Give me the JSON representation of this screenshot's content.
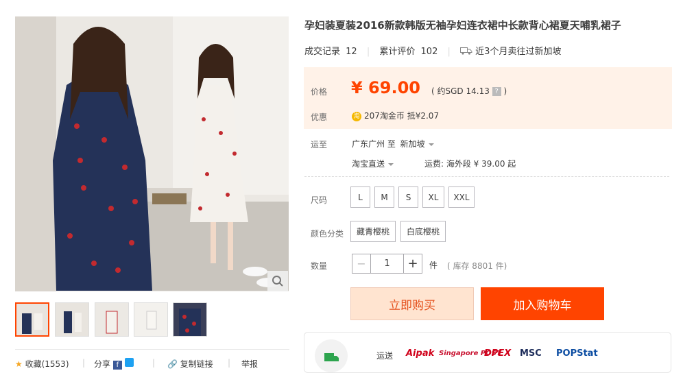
{
  "product": {
    "title": "孕妇装夏装2016新款韩版无袖孕妇连衣裙中长款背心裙夏天哺乳裙子"
  },
  "stats": {
    "sales_label": "成交记录",
    "sales_count": "12",
    "reviews_label": "累计评价",
    "reviews_count": "102",
    "shipping_note": "近3个月卖往过新加坡"
  },
  "price": {
    "label": "价格",
    "value": "¥ 69.00",
    "sgd_prefix": "( 约SGD",
    "sgd_value": "14.13",
    "sgd_suffix": ")",
    "help": "?"
  },
  "promo": {
    "label": "优惠",
    "coin_icon_text": "淘",
    "text": "207淘金币 抵¥2.07"
  },
  "delivery": {
    "label": "运至",
    "from": "广东广州 至",
    "to": "新加坡",
    "method": "淘宝直送",
    "fee": "运费: 海外段 ¥ 39.00 起"
  },
  "size": {
    "label": "尺码",
    "options": [
      "L",
      "M",
      "S",
      "XL",
      "XXL"
    ]
  },
  "color": {
    "label": "颜色分类",
    "options": [
      "藏青樱桃",
      "白底樱桃"
    ]
  },
  "quantity": {
    "label": "数量",
    "value": "1",
    "unit": "件",
    "stock": "( 库存 8801 件)",
    "minus": "−",
    "plus": "+"
  },
  "buttons": {
    "buy_now": "立即购买",
    "add_to_cart": "加入购物车"
  },
  "shipping_partners": {
    "label": "运送",
    "logos": [
      "Aipak",
      "Singapore POST",
      "DPEX",
      "MSC",
      "POPStat"
    ]
  },
  "social": {
    "favorite": "收藏(1553)",
    "share": "分享",
    "share_fb": "f",
    "copy_link": "复制链接",
    "report": "举报"
  },
  "colors": {
    "accent": "#ff4400",
    "price": "#ff4400",
    "price_bg": "#fff2e8",
    "buy_bg": "#ffe4d0"
  }
}
